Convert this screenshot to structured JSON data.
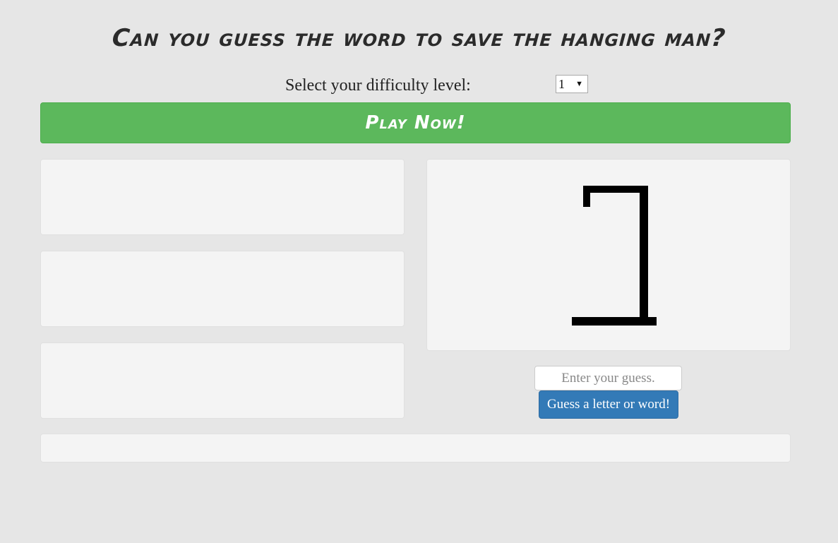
{
  "header": {
    "title": "Can you guess the word to save the hanging man?"
  },
  "difficulty": {
    "label": "Select your difficulty level:",
    "selected": "1"
  },
  "play_button": {
    "label": "Play Now!"
  },
  "game": {
    "hangman_stage_icon": "gallows-icon"
  },
  "guess": {
    "placeholder": "Enter your guess.",
    "value": "",
    "button_label": "Guess a letter or word!"
  },
  "colors": {
    "background": "#e6e6e6",
    "play_button": "#5cb85c",
    "guess_button": "#337ab7",
    "panel": "#f4f4f4"
  }
}
